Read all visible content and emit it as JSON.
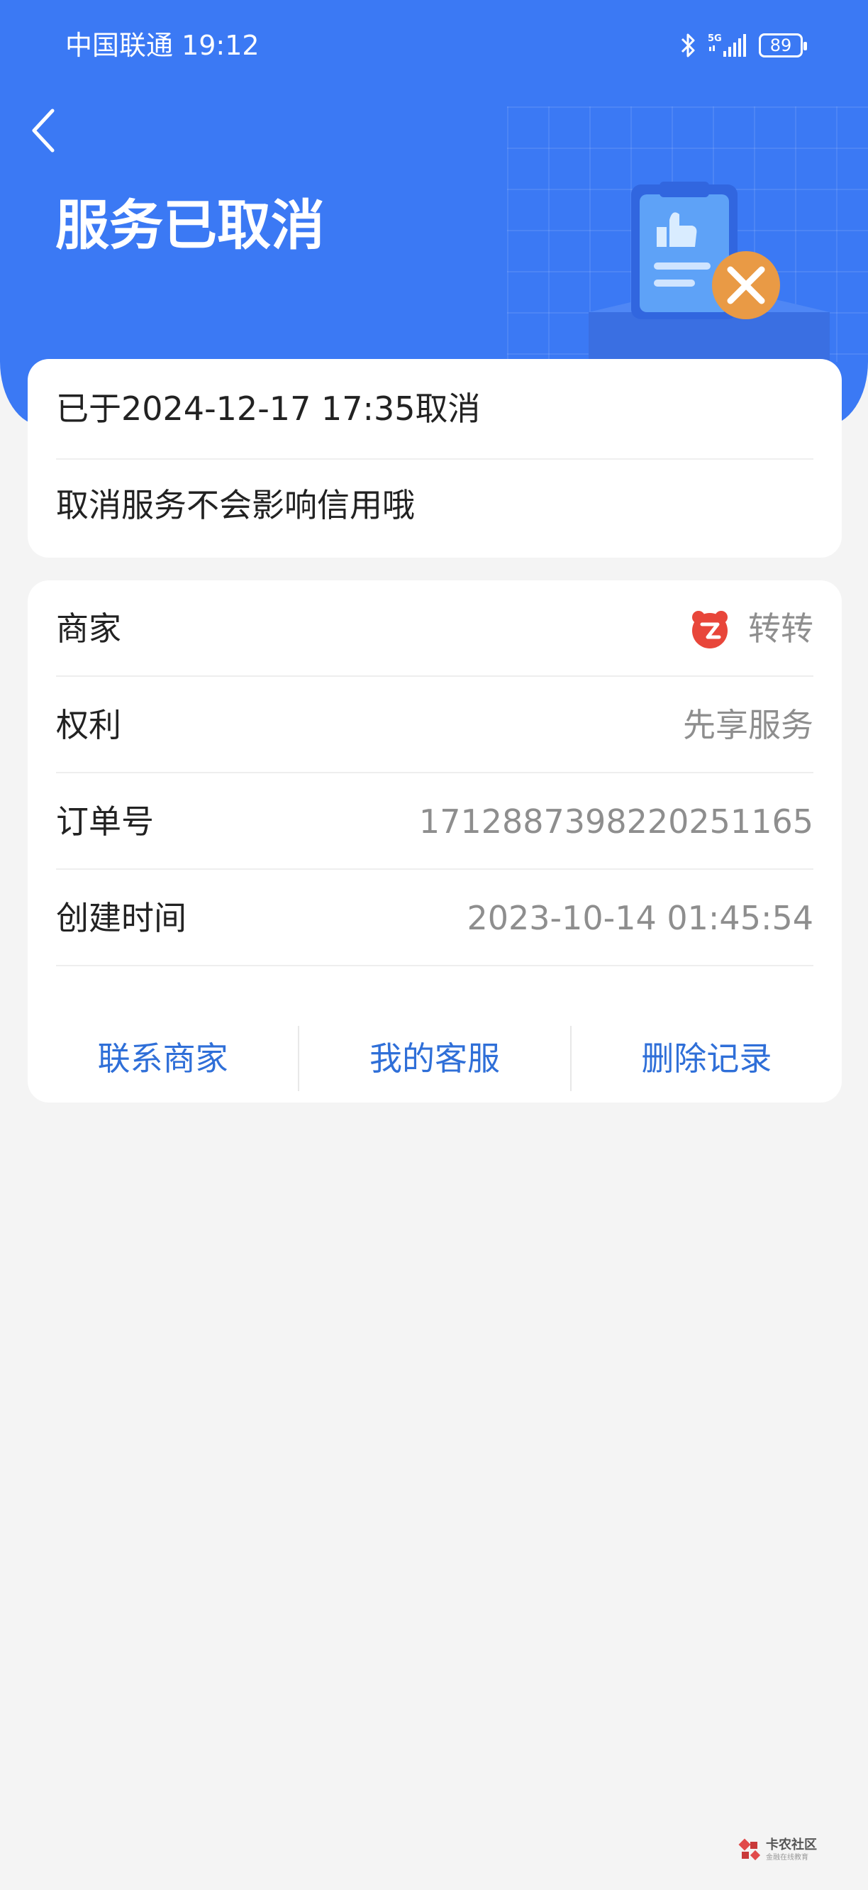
{
  "status_bar": {
    "carrier_time": "中国联通 19:12",
    "network": "5G",
    "battery": "89",
    "icons": [
      "bluetooth-icon",
      "signal-icon",
      "battery-icon"
    ]
  },
  "header": {
    "title": "服务已取消",
    "back_icon": "back-arrow-icon",
    "background_color": "#3b79f4",
    "illustration": "cancelled-document-illustration"
  },
  "cancel_card": {
    "cancel_time": "已于2024-12-17 17:35取消",
    "note": "取消服务不会影响信用哦"
  },
  "info_card": {
    "rows": [
      {
        "label": "商家",
        "value": "转转"
      },
      {
        "label": "权利",
        "value": "先享服务"
      },
      {
        "label": "订单号",
        "value": "1712887398220251165"
      },
      {
        "label": "创建时间",
        "value": "2023-10-14 01:45:54"
      }
    ],
    "actions": [
      "联系商家",
      "我的客服",
      "删除记录"
    ],
    "action_color": "#2f6fd8"
  },
  "watermark": {
    "name": "卡农社区",
    "sub": "金融在线教育"
  }
}
